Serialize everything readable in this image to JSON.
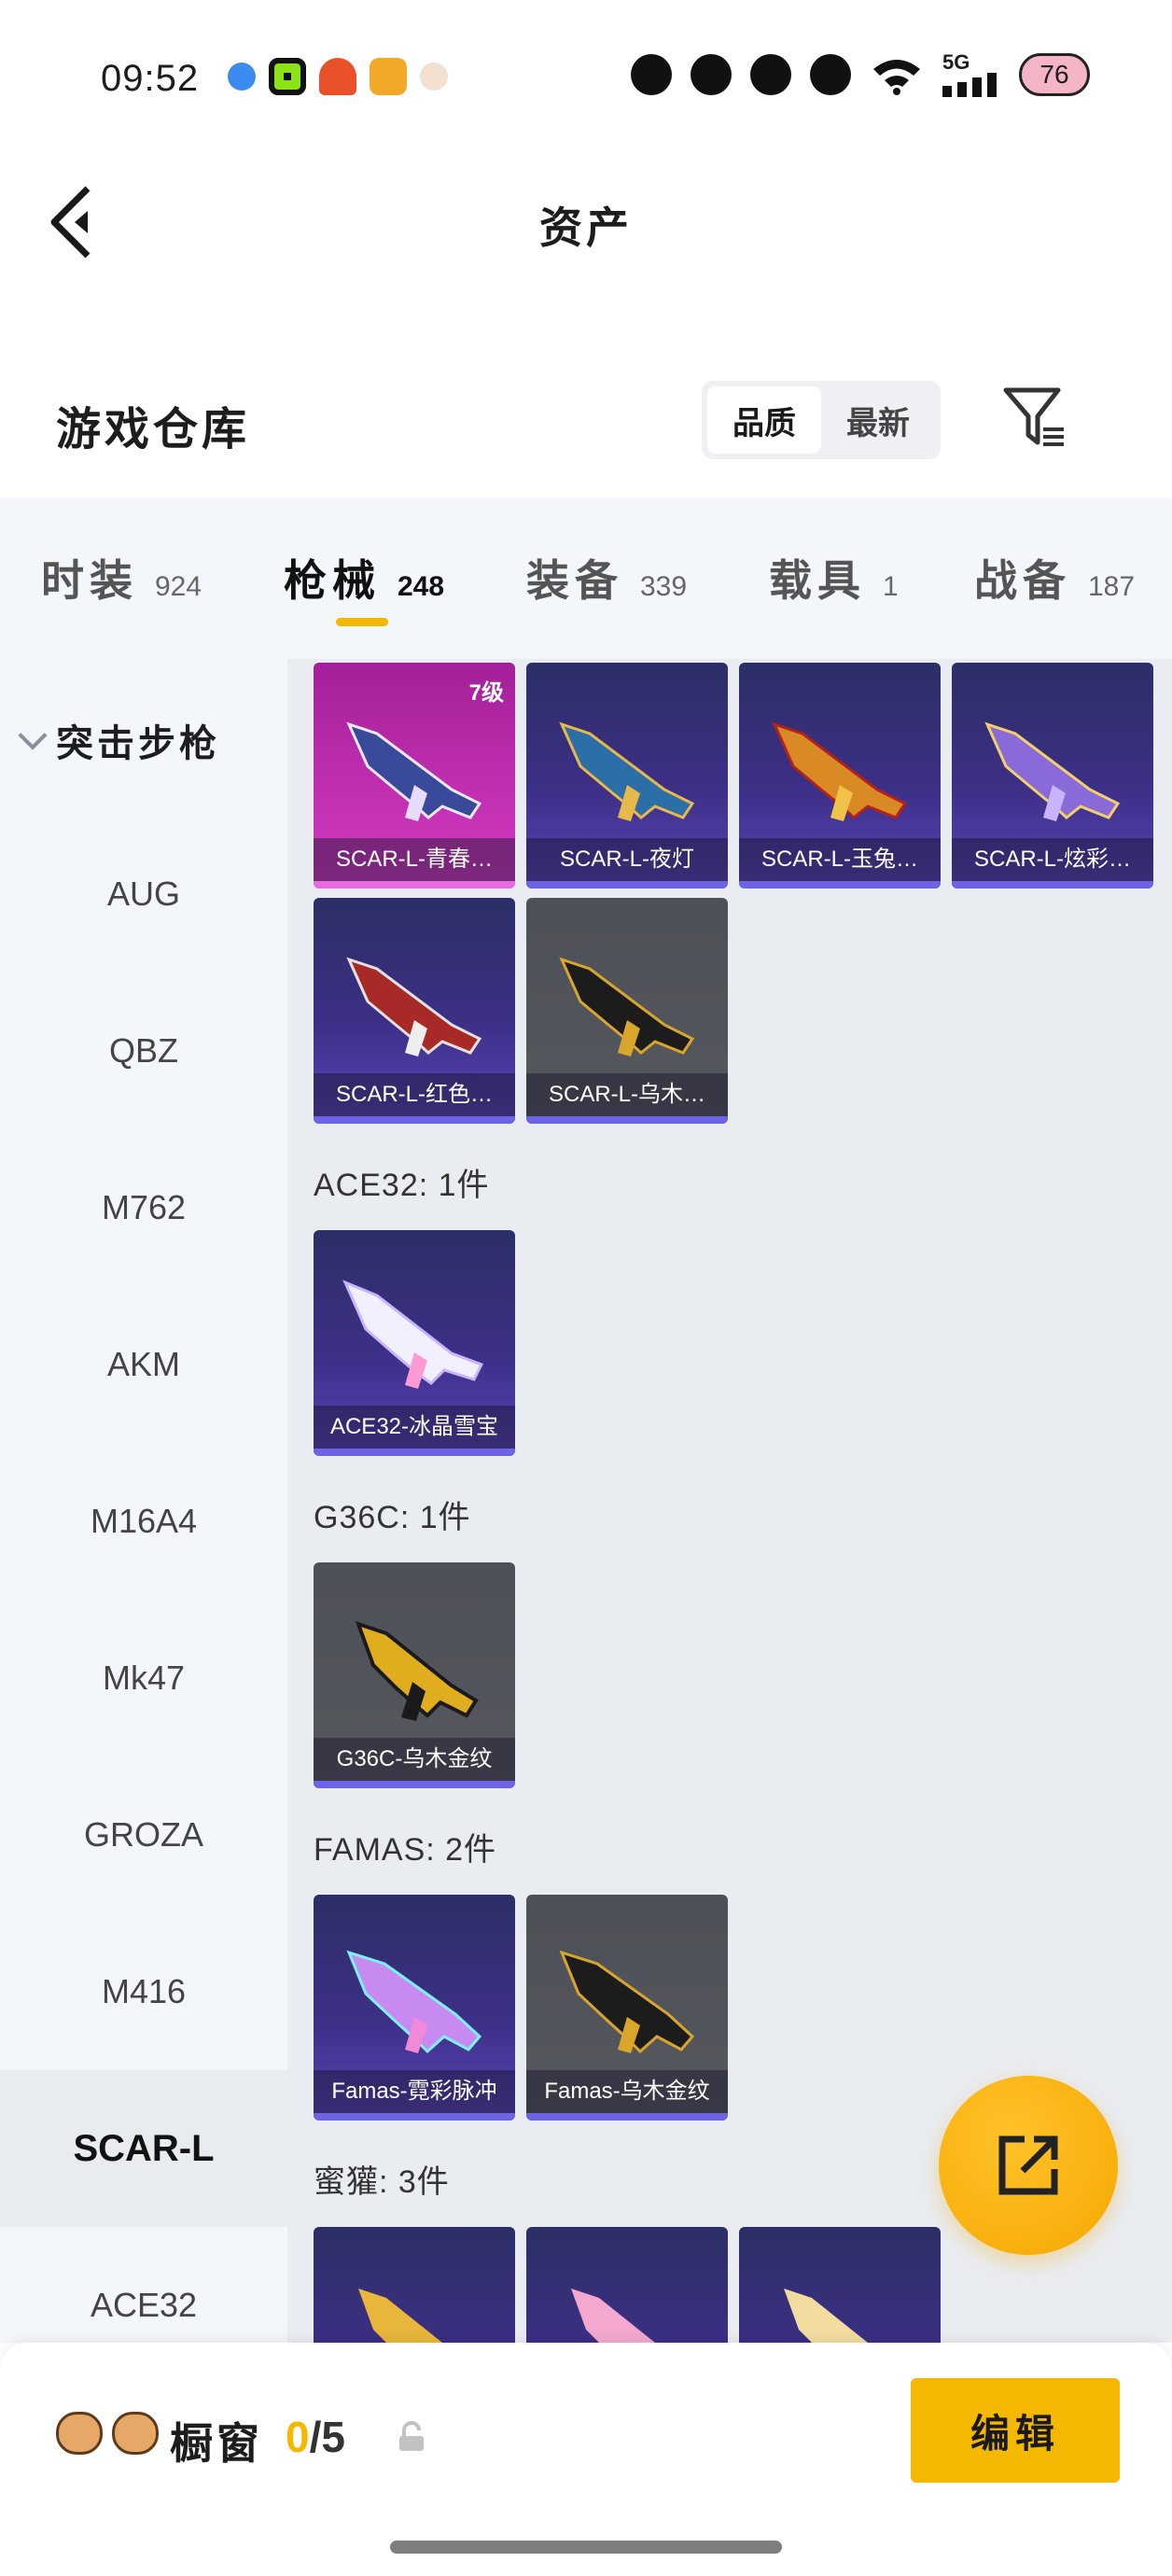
{
  "status_bar": {
    "time": "09:52",
    "network": "5G",
    "battery": "76"
  },
  "header": {
    "title": "资产"
  },
  "section": {
    "title": "游戏仓库"
  },
  "sort": {
    "options": [
      "品质",
      "最新"
    ],
    "active": "品质"
  },
  "tabs": [
    {
      "label": "时装",
      "count": "924"
    },
    {
      "label": "枪械",
      "count": "248"
    },
    {
      "label": "装备",
      "count": "339"
    },
    {
      "label": "载具",
      "count": "1"
    },
    {
      "label": "战备",
      "count": "187"
    }
  ],
  "active_tab": "枪械",
  "sidebar": {
    "group": "突击步枪",
    "items": [
      "AUG",
      "QBZ",
      "M762",
      "AKM",
      "M16A4",
      "Mk47",
      "GROZA",
      "M416",
      "SCAR-L",
      "ACE32"
    ],
    "active": "SCAR-L"
  },
  "content": {
    "scar_items": [
      {
        "name": "SCAR-L-青春…",
        "badge": "7级",
        "rarity": "pink"
      },
      {
        "name": "SCAR-L-夜灯",
        "rarity": "purple"
      },
      {
        "name": "SCAR-L-玉兔…",
        "rarity": "purple"
      },
      {
        "name": "SCAR-L-炫彩…",
        "rarity": "purple"
      },
      {
        "name": "SCAR-L-红色…",
        "rarity": "purple"
      },
      {
        "name": "SCAR-L-乌木…",
        "rarity": "gray"
      }
    ],
    "groups": [
      {
        "label": "ACE32: 1件",
        "items": [
          {
            "name": "ACE32-冰晶雪宝",
            "rarity": "purple"
          }
        ]
      },
      {
        "label": "G36C: 1件",
        "items": [
          {
            "name": "G36C-乌木金纹",
            "rarity": "gray"
          }
        ]
      },
      {
        "label": "FAMAS: 2件",
        "items": [
          {
            "name": "Famas-霓彩脉冲",
            "rarity": "purple"
          },
          {
            "name": "Famas-乌木金纹",
            "rarity": "gray"
          }
        ]
      },
      {
        "label": "蜜獾: 3件",
        "items": []
      }
    ]
  },
  "bottom": {
    "label": "橱窗",
    "current": "0",
    "total": "/5",
    "edit": "编辑"
  },
  "colors": {
    "accent": "#f5b800",
    "pink_rarity": "#c02fb0",
    "purple_rarity": "#3c2f86",
    "gray_rarity": "#56585f"
  }
}
